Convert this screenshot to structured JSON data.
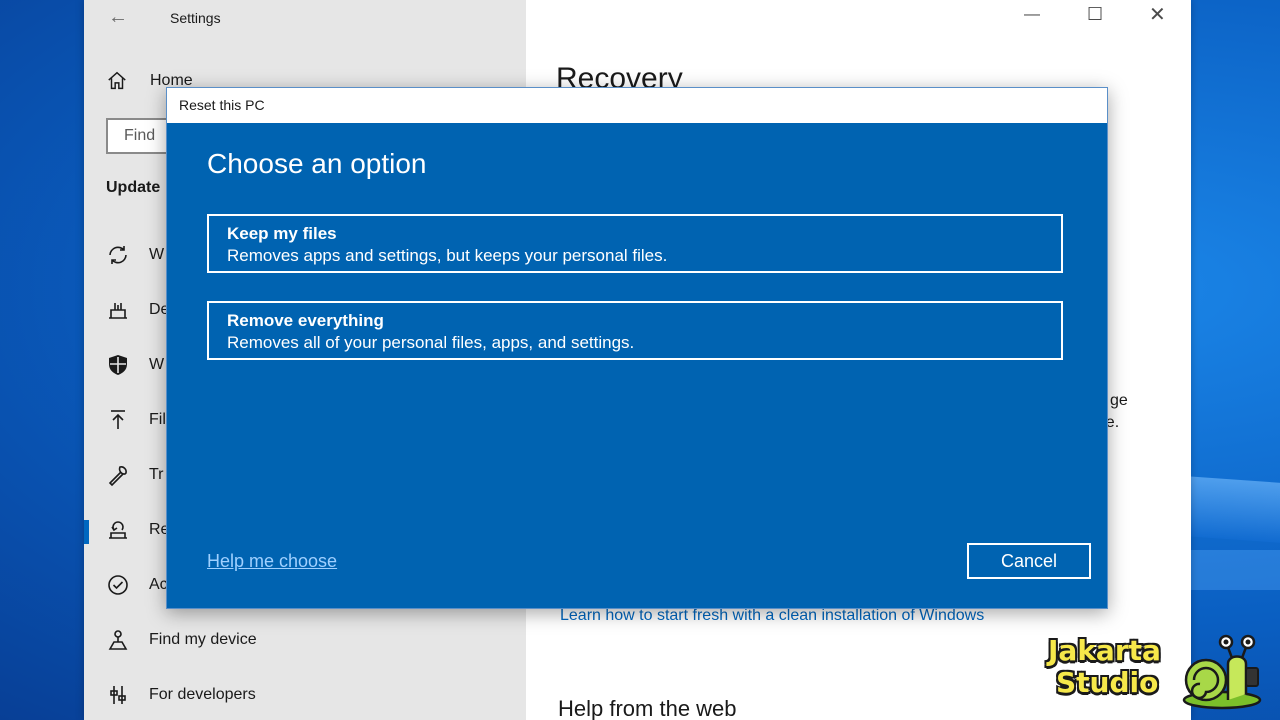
{
  "window": {
    "title": "Settings"
  },
  "sidebar": {
    "home_label": "Home",
    "search_placeholder": "Find",
    "section_heading": "Update",
    "items": [
      {
        "label": "W",
        "icon": "sync-icon"
      },
      {
        "label": "De",
        "icon": "delivery-optimization-icon"
      },
      {
        "label": "W",
        "icon": "shield-icon"
      },
      {
        "label": "Fil",
        "icon": "backup-upload-icon"
      },
      {
        "label": "Tr",
        "icon": "wrench-icon"
      },
      {
        "label": "Re",
        "icon": "recovery-icon",
        "selected": true
      },
      {
        "label": "Ac",
        "icon": "activation-check-icon"
      },
      {
        "label": "Find my device",
        "icon": "find-device-icon"
      },
      {
        "label": "For developers",
        "icon": "developer-tools-icon"
      }
    ]
  },
  "content": {
    "title": "Recovery",
    "fragment_1": "ge",
    "fragment_2": "age.",
    "learn_link": "Learn how to start fresh with a clean installation of Windows",
    "help_heading": "Help from the web"
  },
  "dialog": {
    "title": "Reset this PC",
    "heading": "Choose an option",
    "options": [
      {
        "title": "Keep my files",
        "description": "Removes apps and settings, but keeps your personal files."
      },
      {
        "title": "Remove everything",
        "description": "Removes all of your personal files, apps, and settings."
      }
    ],
    "help_link": "Help me choose",
    "cancel_label": "Cancel"
  },
  "watermark": {
    "line1": "Jakarta",
    "line2": "Studio"
  },
  "colors": {
    "dialog_bg": "#0063b1",
    "accent": "#0067c0",
    "link_light": "#9fd0ff",
    "logo_yellow": "#f6e84a"
  }
}
